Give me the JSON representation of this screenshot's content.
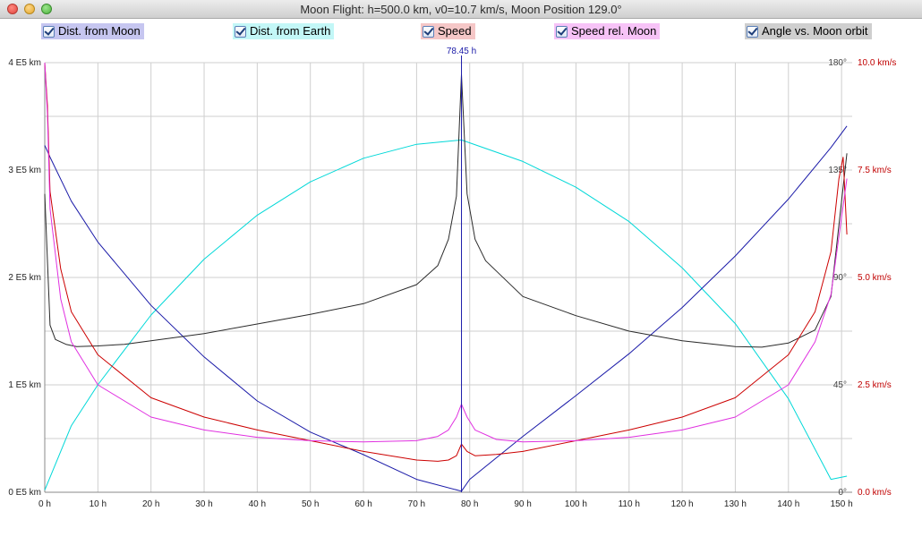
{
  "window": {
    "title": "Moon Flight: h=500.0 km, v0=10.7 km/s,  Moon Position 129.0°"
  },
  "toolbar": {
    "checkboxes": [
      {
        "label": "Dist. from Moon",
        "checked": true,
        "bg": "#c6c6f0"
      },
      {
        "label": "Dist. from Earth",
        "checked": true,
        "bg": "#c3f7f7"
      },
      {
        "label": "Speed",
        "checked": true,
        "bg": "#f5c7c7"
      },
      {
        "label": "Speed rel. Moon",
        "checked": true,
        "bg": "#f7c3f7"
      },
      {
        "label": "Angle vs. Moon orbit",
        "checked": true,
        "bg": "#cfcfcf"
      }
    ]
  },
  "chart_data": {
    "type": "line",
    "marker_label": "78.45 h",
    "marker_time": 78.45,
    "x_ticks": [
      "0 h",
      "10 h",
      "20 h",
      "30 h",
      "40 h",
      "50 h",
      "60 h",
      "70 h",
      "80 h",
      "90 h",
      "100 h",
      "110 h",
      "120 h",
      "130 h",
      "140 h",
      "150 h"
    ],
    "xlim": [
      0,
      152
    ],
    "y_left_ticks": [
      "0 E5 km",
      "1 E5 km",
      "2 E5 km",
      "3 E5 km",
      "4 E5 km"
    ],
    "y_left_lim": [
      0,
      4
    ],
    "y_angle_ticks": [
      "0°",
      "45°",
      "90°",
      "135°",
      "180°"
    ],
    "y_angle_lim": [
      0,
      180
    ],
    "y_speed_ticks": [
      "0.0 km/s",
      "2.5 km/s",
      "5.0 km/s",
      "7.5 km/s",
      "10.0 km/s"
    ],
    "y_speed_lim": [
      0,
      10
    ],
    "series": [
      {
        "name": "Dist. from Earth",
        "color": "#00d8d8",
        "axis": "left",
        "x": [
          0,
          5,
          10,
          20,
          30,
          40,
          50,
          60,
          70,
          78.45,
          90,
          100,
          110,
          120,
          130,
          140,
          148,
          151
        ],
        "y": [
          0.02,
          0.62,
          1.0,
          1.65,
          2.17,
          2.58,
          2.89,
          3.11,
          3.24,
          3.28,
          3.08,
          2.84,
          2.52,
          2.09,
          1.57,
          0.87,
          0.12,
          0.15
        ]
      },
      {
        "name": "Dist. from Moon",
        "color": "#1a1aa8",
        "axis": "left",
        "x": [
          0,
          1,
          5,
          10,
          20,
          30,
          40,
          50,
          60,
          70,
          78.45,
          80,
          90,
          100,
          110,
          120,
          130,
          140,
          148,
          151
        ],
        "y": [
          3.23,
          3.12,
          2.71,
          2.33,
          1.74,
          1.26,
          0.85,
          0.56,
          0.35,
          0.12,
          0.01,
          0.12,
          0.52,
          0.9,
          1.29,
          1.72,
          2.2,
          2.73,
          3.21,
          3.41
        ]
      },
      {
        "name": "Angle vs. Moon orbit",
        "color": "#2a2a2a",
        "axis": "angle",
        "x": [
          0,
          1,
          2,
          4,
          6,
          10,
          15,
          20,
          30,
          40,
          50,
          60,
          70,
          74,
          76,
          77.5,
          78.45,
          79.5,
          81,
          83,
          90,
          100,
          110,
          120,
          130,
          135,
          140,
          145,
          148,
          151
        ],
        "y": [
          125,
          70,
          64,
          62,
          61,
          61.3,
          62,
          63.5,
          66.5,
          70.5,
          74.5,
          79,
          87,
          95,
          106,
          124,
          175,
          125,
          106,
          97,
          82,
          74,
          67.5,
          63.5,
          61,
          60.8,
          62.5,
          68,
          82,
          142
        ]
      },
      {
        "name": "Speed",
        "color": "#cc0000",
        "axis": "speed",
        "x": [
          0,
          0.5,
          1,
          3,
          5,
          10,
          20,
          30,
          40,
          50,
          60,
          70,
          74,
          76,
          77.5,
          78.45,
          79.5,
          81,
          85,
          90,
          100,
          110,
          120,
          130,
          140,
          145,
          148,
          149.5,
          150.3,
          151
        ],
        "y": [
          10.0,
          9.0,
          7.0,
          5.2,
          4.2,
          3.2,
          2.2,
          1.75,
          1.45,
          1.2,
          0.95,
          0.75,
          0.72,
          0.75,
          0.85,
          1.12,
          0.95,
          0.85,
          0.88,
          0.95,
          1.2,
          1.45,
          1.75,
          2.2,
          3.2,
          4.2,
          5.6,
          7.3,
          7.8,
          6.0
        ]
      },
      {
        "name": "Speed rel. Moon",
        "color": "#e030e0",
        "axis": "speed",
        "x": [
          0,
          0.5,
          1,
          3,
          5,
          10,
          20,
          30,
          40,
          50,
          60,
          70,
          74,
          76,
          77.5,
          78.45,
          79.5,
          81,
          85,
          90,
          100,
          110,
          120,
          130,
          140,
          145,
          148,
          150,
          151
        ],
        "y": [
          10.0,
          8.8,
          6.6,
          4.5,
          3.5,
          2.5,
          1.75,
          1.45,
          1.28,
          1.2,
          1.17,
          1.2,
          1.3,
          1.45,
          1.75,
          2.05,
          1.75,
          1.45,
          1.23,
          1.17,
          1.2,
          1.28,
          1.45,
          1.75,
          2.5,
          3.5,
          4.6,
          6.4,
          7.3
        ]
      }
    ]
  }
}
